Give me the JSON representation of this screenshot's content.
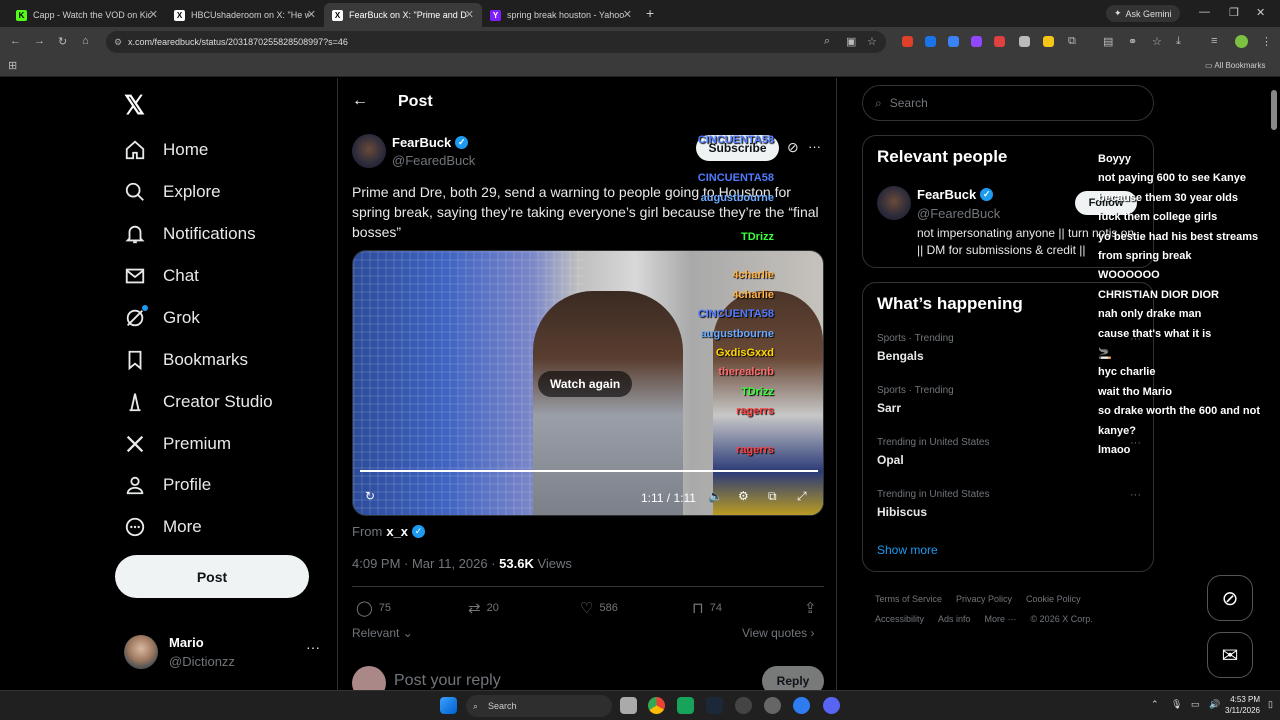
{
  "browser": {
    "tabs": [
      {
        "title": "Capp - Watch the VOD on Kick",
        "fav_color": "#53fc18",
        "fav": "K"
      },
      {
        "title": "HBCUshaderoom on X: \"He w...",
        "fav_color": "#ffffff",
        "fav": "X"
      },
      {
        "title": "FearBuck on X: \"Prime and Dre...",
        "fav_color": "#ffffff",
        "fav": "X"
      },
      {
        "title": "spring break houston - Yahoo S...",
        "fav_color": "#7e1fff",
        "fav": "Y"
      }
    ],
    "ask_gemini": "Ask Gemini",
    "url": "x.com/fearedbuck/status/2031870255828508997?s=46",
    "all_bookmarks": "All Bookmarks"
  },
  "nav": {
    "logo": "𝕏",
    "items": [
      {
        "label": "Home",
        "icon": "home-icon"
      },
      {
        "label": "Explore",
        "icon": "search-icon"
      },
      {
        "label": "Notifications",
        "icon": "bell-icon"
      },
      {
        "label": "Chat",
        "icon": "mail-icon"
      },
      {
        "label": "Grok",
        "icon": "grok-icon"
      },
      {
        "label": "Bookmarks",
        "icon": "bookmark-icon"
      },
      {
        "label": "Creator Studio",
        "icon": "creator-icon"
      },
      {
        "label": "Premium",
        "icon": "x-icon"
      },
      {
        "label": "Profile",
        "icon": "person-icon"
      },
      {
        "label": "More",
        "icon": "more-circle-icon"
      }
    ],
    "post_button": "Post",
    "account": {
      "name": "Mario",
      "handle": "@Dictionzz"
    }
  },
  "post": {
    "header_title": "Post",
    "author_name": "FearBuck",
    "author_handle": "@FearedBuck",
    "subscribe": "Subscribe",
    "text": "Prime and Dre, both 29, send a warning to people going to Houston for spring break, saying they’re taking everyone’s girl because they’re the “final bosses”",
    "video": {
      "watch_again": "Watch again",
      "time": "1:11 / 1:11",
      "progress": 1.0
    },
    "from_label": "From",
    "from_user": "x_x",
    "timestamp": "4:09 PM · Mar 11, 2026 · ",
    "views_count": "53.6K",
    "views_label": " Views",
    "actions": {
      "replies": "75",
      "reposts": "20",
      "likes": "586",
      "bookmarks": "74"
    },
    "relevant": "Relevant",
    "view_quotes": "View quotes",
    "reply_placeholder": "Post your reply",
    "reply_button": "Reply"
  },
  "sidebar": {
    "search_placeholder": "Search",
    "relevant_title": "Relevant people",
    "person": {
      "name": "FearBuck",
      "handle": "@FearedBuck",
      "bio": "not impersonating anyone || turn notis on || DM for submissions & credit ||",
      "follow": "Follow"
    },
    "happening_title": "What’s happening",
    "trends": [
      {
        "context": "Sports · Trending",
        "name": "Bengals"
      },
      {
        "context": "Sports · Trending",
        "name": "Sarr"
      },
      {
        "context": "Trending in United States",
        "name": "Opal"
      },
      {
        "context": "Trending in United States",
        "name": "Hibiscus"
      }
    ],
    "show_more": "Show more",
    "footer": [
      "Terms of Service",
      "Privacy Policy",
      "Cookie Policy",
      "Accessibility",
      "Ads info",
      "More ···",
      "© 2026 X Corp."
    ]
  },
  "chat_overlay": [
    {
      "user": "",
      "color": "#ffffff",
      "msg": "Boyyy"
    },
    {
      "user": "CINCUENTA58",
      "color": "#4f7bff",
      "msg": "not paying 600 to see Kanye"
    },
    {
      "user": "augustbourne",
      "color": "#6aa9ff",
      "msg": "because them 30 year olds"
    },
    {
      "user": "",
      "color": "#ffffff",
      "msg": "fuck them college girls"
    },
    {
      "user": "TDrizz",
      "color": "#3cff3c",
      "msg": "yo bestie had his best streams"
    },
    {
      "user": "",
      "color": "#ffffff",
      "msg": "from spring break"
    },
    {
      "user": "4charlie",
      "color": "#ffb347",
      "msg": "WOOOOOO"
    },
    {
      "user": "4charlie",
      "color": "#ffb347",
      "msg": "CHRISTIAN DIOR DIOR"
    },
    {
      "user": "CINCUENTA58",
      "color": "#4f7bff",
      "msg": "nah only drake man"
    },
    {
      "user": "augustbourne",
      "color": "#6aa9ff",
      "msg": "cause that's what it is"
    },
    {
      "user": "GxdisGxxd",
      "color": "#ffd700",
      "msg": "🚬"
    },
    {
      "user": "therealcnb",
      "color": "#ff6b6b",
      "msg": "hyc charlie"
    },
    {
      "user": "TDrizz",
      "color": "#3cff3c",
      "msg": "wait tho Mario"
    },
    {
      "user": "ragerrs",
      "color": "#ff4040",
      "msg": "so drake worth the 600 and not"
    },
    {
      "user": "",
      "color": "#ffffff",
      "msg": "kanye?"
    },
    {
      "user": "ragerrs",
      "color": "#ff4040",
      "msg": "lmaoo"
    }
  ],
  "chat_header_user": "CINCUENTA58",
  "taskbar": {
    "search": "Search",
    "time": "4:53 PM",
    "date": "3/11/2026"
  }
}
